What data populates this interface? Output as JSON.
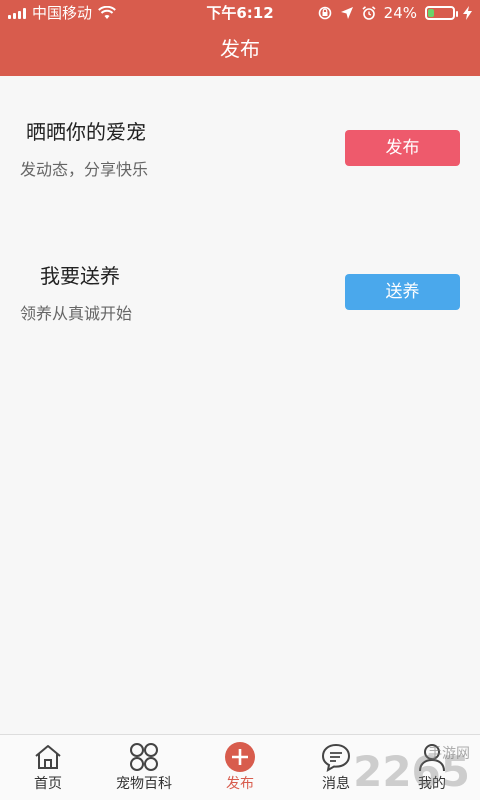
{
  "status_bar": {
    "carrier": "中国移动",
    "time": "下午6:12",
    "battery_percent": "24%",
    "battery_level": 0.24
  },
  "header": {
    "title": "发布"
  },
  "rows": [
    {
      "title": "晒晒你的爱宠",
      "subtitle": "发动态，分享快乐",
      "button_label": "发布",
      "button_color": "#ee5a6c"
    },
    {
      "title": "我要送养",
      "subtitle": "领养从真诚开始",
      "button_label": "送养",
      "button_color": "#4aa8ec"
    }
  ],
  "tabbar": {
    "tabs": [
      {
        "label": "首页",
        "icon": "home-icon"
      },
      {
        "label": "宠物百科",
        "icon": "encyclopedia-icon"
      },
      {
        "label": "发布",
        "icon": "add-circle-icon",
        "active": true
      },
      {
        "label": "消息",
        "icon": "message-icon"
      },
      {
        "label": "我的",
        "icon": "user-icon"
      }
    ],
    "accent_color": "#d85c4d"
  },
  "watermark": {
    "text": "2265",
    "small": "手游网"
  }
}
